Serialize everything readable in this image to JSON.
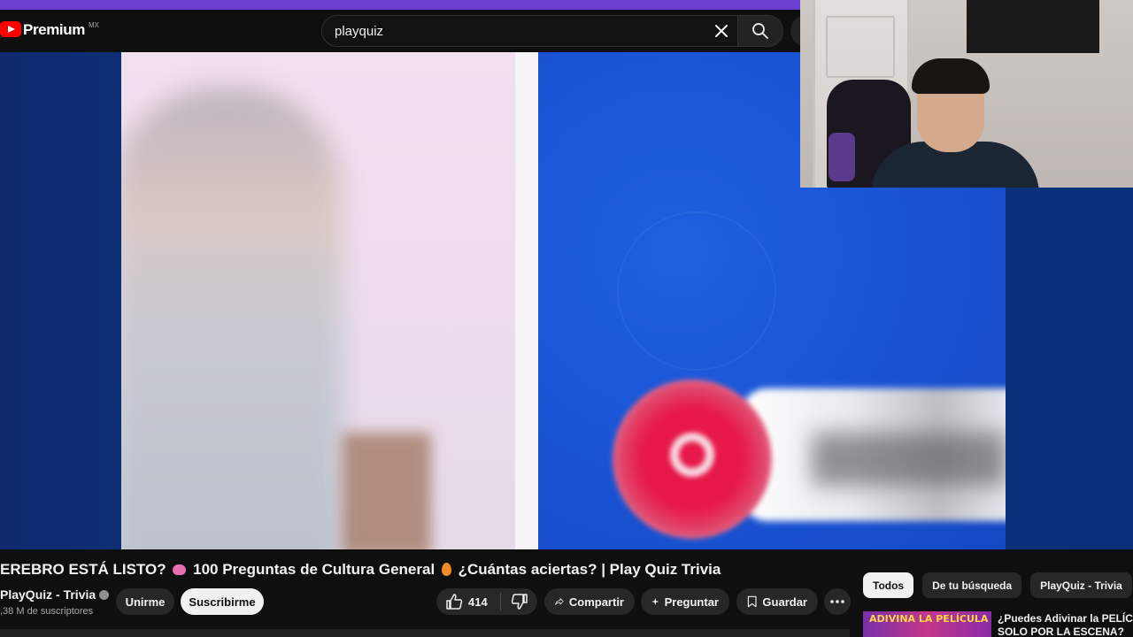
{
  "colors": {
    "top_strip": "#6d3fd1",
    "accent_red": "#ff0000",
    "background": "#0f0f0f"
  },
  "header": {
    "logo_text": "Premium",
    "logo_region": "MX",
    "search_value": "playquiz",
    "icons": [
      "youtube-logo-icon",
      "close-icon",
      "search-icon"
    ]
  },
  "video": {
    "title_part1": "EREBRO ESTÁ LISTO?",
    "title_part2": "100 Preguntas de Cultura General",
    "title_part3": "¿Cuántas aciertas? | Play Quiz Trivia"
  },
  "channel": {
    "name": "PlayQuiz - Trivia",
    "subscribers": ",38 M de suscriptores",
    "join_label": "Unirme",
    "subscribe_label": "Suscribirme"
  },
  "actions": {
    "like_count": "414",
    "share_label": "Compartir",
    "ask_label": "Preguntar",
    "save_label": "Guardar",
    "icons": [
      "thumbs-up-icon",
      "thumbs-down-icon",
      "share-icon",
      "sparkle-icon",
      "bookmark-icon",
      "more-icon"
    ]
  },
  "sidebar": {
    "chips": [
      {
        "label": "Todos",
        "active": true
      },
      {
        "label": "De tu búsqueda",
        "active": false
      },
      {
        "label": "PlayQuiz - Trivia",
        "active": false
      }
    ],
    "recommendation": {
      "thumb_text": "ADIVINA LA PELÍCULA",
      "title_line1": "¿Puedes Adivinar la PELÍCULA",
      "title_line2": "SOLO POR LA ESCENA?"
    }
  }
}
